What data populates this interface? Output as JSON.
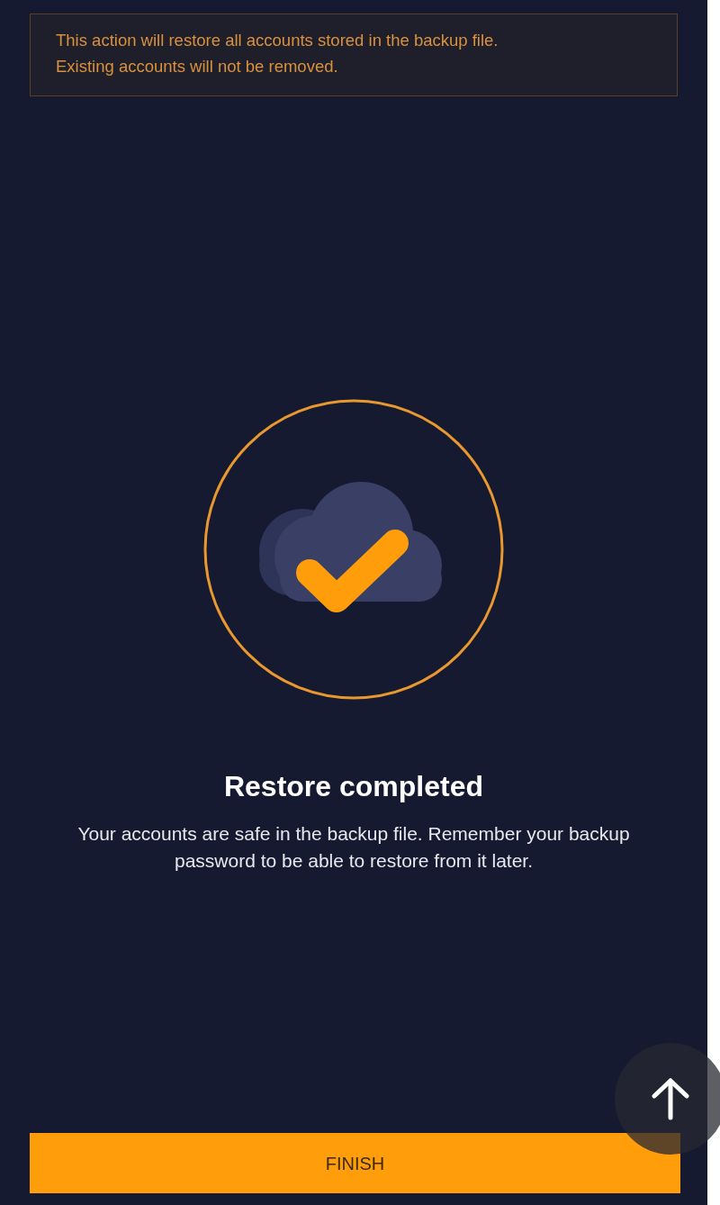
{
  "notice": {
    "lines": [
      "This action will restore all accounts stored in the backup file.",
      "Existing accounts will not be removed."
    ]
  },
  "result": {
    "title": "Restore completed",
    "message": "Your accounts are safe in the backup file. Remember your backup password to be able to restore from it later."
  },
  "finish_button": {
    "label": "FINISH"
  }
}
